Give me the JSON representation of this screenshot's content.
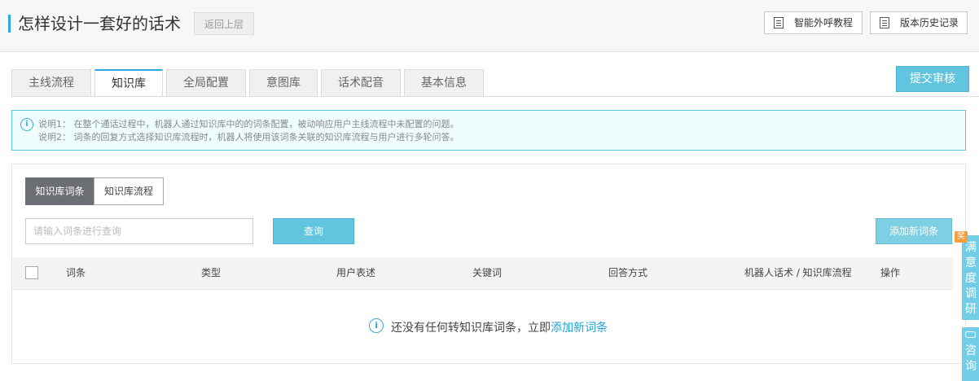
{
  "header": {
    "title": "怎样设计一套好的话术",
    "back_label": "返回上层",
    "buttons": [
      {
        "label": "智能外呼教程",
        "icon": "document-icon"
      },
      {
        "label": "版本历史记录",
        "icon": "document-icon"
      }
    ]
  },
  "tabs": [
    {
      "label": "主线流程",
      "active": false
    },
    {
      "label": "知识库",
      "active": true
    },
    {
      "label": "全局配置",
      "active": false
    },
    {
      "label": "意图库",
      "active": false
    },
    {
      "label": "话术配音",
      "active": false
    },
    {
      "label": "基本信息",
      "active": false
    }
  ],
  "submit_label": "提交审核",
  "info": {
    "lines": [
      "说明1： 在整个通话过程中，机器人通过知识库中的的词条配置，被动响应用户主线流程中未配置的问题。",
      "说明2： 词条的回复方式选择知识库流程时，机器人将使用该词条关联的知识库流程与用户进行多轮问答。"
    ]
  },
  "subtabs": [
    {
      "label": "知识库词条",
      "active": true
    },
    {
      "label": "知识库流程",
      "active": false
    }
  ],
  "search": {
    "placeholder": "请输入词条进行查询",
    "value": "",
    "button_label": "查询"
  },
  "add_label": "添加新词条",
  "table": {
    "columns": [
      "词条",
      "类型",
      "用户表述",
      "关键词",
      "回答方式",
      "机器人话术 / 知识库流程",
      "操作"
    ]
  },
  "empty": {
    "text": "还没有任何转知识库词条，立即",
    "link": "添加新词条"
  },
  "side": {
    "survey": [
      "满",
      "意",
      "度",
      "调",
      "研"
    ],
    "badge": "奖",
    "consult": [
      "咨",
      "询"
    ]
  },
  "colors": {
    "accent": "#2ea7e0",
    "button": "#62c5e0",
    "info_bg": "#effdff",
    "info_border": "#56c6dc"
  }
}
